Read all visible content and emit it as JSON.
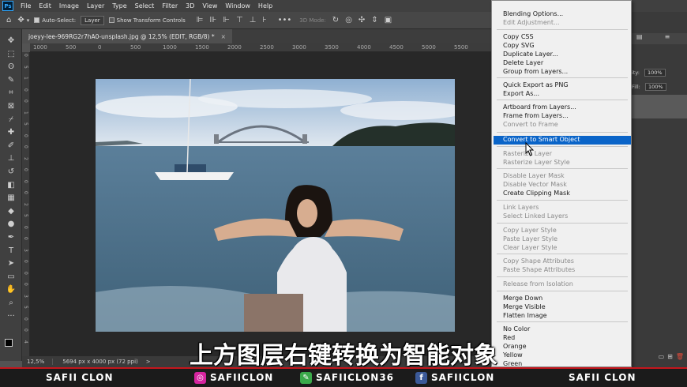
{
  "app": {
    "logo_text": "Ps"
  },
  "menubar": [
    "File",
    "Edit",
    "Image",
    "Layer",
    "Type",
    "Select",
    "Filter",
    "3D",
    "View",
    "Window",
    "Help"
  ],
  "options": {
    "auto_select_label": "Auto-Select:",
    "auto_select_checked": true,
    "auto_select_value": "Layer",
    "transform_label": "Show Transform Controls",
    "transform_checked": false,
    "mode_3d": "3D Mode:"
  },
  "document": {
    "tab_title": "joeyy-lee-969RG2r7hA0-unsplash.jpg @ 12,5% (EDIT, RGB/8) *",
    "close_glyph": "×"
  },
  "ruler": {
    "h_ticks": [
      "1000",
      "500",
      "0",
      "500",
      "1000",
      "1500",
      "2000",
      "2500",
      "3000",
      "3500",
      "4000",
      "4500",
      "5000",
      "5500"
    ],
    "v_ticks": [
      "0",
      "5",
      "1",
      "0",
      "0",
      "1",
      "5",
      "0",
      "0",
      "2",
      "0",
      "0",
      "0",
      "2",
      "5",
      "0",
      "0",
      "3",
      "0",
      "0",
      "0",
      "3",
      "5",
      "0",
      "0",
      "4"
    ]
  },
  "status": {
    "zoom": "12,5%",
    "doc_info": "5694 px x 4000 px (72 ppi)",
    "arrow": ">"
  },
  "right_panel": {
    "opacity_label": "ity:",
    "opacity_value": "100%",
    "fill_label": "Fill:",
    "fill_value": "100%"
  },
  "context_menu": {
    "highlighted": "Convert to Smart Object",
    "items": [
      {
        "label": "Blending Options...",
        "disabled": false
      },
      {
        "label": "Edit Adjustment...",
        "disabled": true
      },
      {
        "label": "Copy CSS",
        "disabled": false
      },
      {
        "label": "Copy SVG",
        "disabled": false
      },
      {
        "label": "Duplicate Layer...",
        "disabled": false
      },
      {
        "label": "Delete Layer",
        "disabled": false
      },
      {
        "label": "Group from Layers...",
        "disabled": false
      },
      {
        "label": "Quick Export as PNG",
        "disabled": false
      },
      {
        "label": "Export As...",
        "disabled": false
      },
      {
        "label": "Artboard from Layers...",
        "disabled": false
      },
      {
        "label": "Frame from Layers...",
        "disabled": false
      },
      {
        "label": "Convert to Frame",
        "disabled": true
      },
      {
        "label": "Convert to Smart Object",
        "disabled": false
      },
      {
        "label": "Rasterize Layer",
        "disabled": true
      },
      {
        "label": "Rasterize Layer Style",
        "disabled": true
      },
      {
        "label": "Disable Layer Mask",
        "disabled": true
      },
      {
        "label": "Disable Vector Mask",
        "disabled": true
      },
      {
        "label": "Create Clipping Mask",
        "disabled": false
      },
      {
        "label": "Link Layers",
        "disabled": true
      },
      {
        "label": "Select Linked Layers",
        "disabled": true
      },
      {
        "label": "Copy Layer Style",
        "disabled": true
      },
      {
        "label": "Paste Layer Style",
        "disabled": true
      },
      {
        "label": "Clear Layer Style",
        "disabled": true
      },
      {
        "label": "Copy Shape Attributes",
        "disabled": true
      },
      {
        "label": "Paste Shape Attributes",
        "disabled": true
      },
      {
        "label": "Release from Isolation",
        "disabled": true
      },
      {
        "label": "Merge Down",
        "disabled": false
      },
      {
        "label": "Merge Visible",
        "disabled": false
      },
      {
        "label": "Flatten Image",
        "disabled": false
      },
      {
        "label": "No Color",
        "disabled": false
      },
      {
        "label": "Red",
        "disabled": false
      },
      {
        "label": "Orange",
        "disabled": false
      },
      {
        "label": "Yellow",
        "disabled": false
      },
      {
        "label": "Green",
        "disabled": false
      }
    ]
  },
  "subtitle": "上方图层右键转换为智能对象",
  "banner": {
    "left_name": "SAFII CLON",
    "instagram": "SAFIICLON",
    "other": "SAFIICLON36",
    "facebook": "SAFIICLON",
    "right_name": "SAFII CLON",
    "accent": "#c4161c"
  },
  "colors": {
    "highlight": "#0a64c8",
    "ps_blue": "#31a8ff"
  }
}
